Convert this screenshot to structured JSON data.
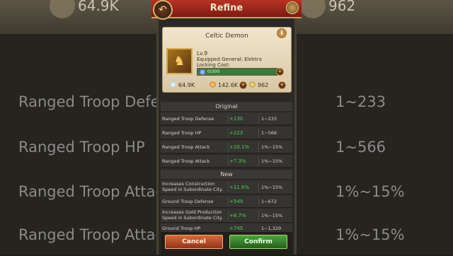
{
  "background": {
    "top_values": [
      "64.9K",
      "962"
    ],
    "rows": [
      {
        "label": "Ranged Troop Defe",
        "value": "1~233"
      },
      {
        "label": "Ranged Troop HP",
        "value": "1~566"
      },
      {
        "label": "Ranged Troop Attac",
        "value": "1%~15%"
      },
      {
        "label": "Ranged Troop Attac",
        "value": "1%~15%"
      }
    ]
  },
  "header": {
    "title": "Refine"
  },
  "card": {
    "name": "Celtic Demon",
    "level": "Lv.9",
    "equipped": "Equipped General: Elektra",
    "locking_label": "Locking Cost:",
    "locking_value": "0/300",
    "gems": "64.9K",
    "hammers": "142.6K",
    "coins": "962"
  },
  "original": {
    "heading": "Original",
    "rows": [
      {
        "name": "Ranged Troop Defense",
        "value": "+130",
        "range": "1~233"
      },
      {
        "name": "Ranged Troop HP",
        "value": "+223",
        "range": "1~566"
      },
      {
        "name": "Ranged Troop Attack",
        "value": "+10.1%",
        "range": "1%~15%"
      },
      {
        "name": "Ranged Troop Attack",
        "value": "+7.3%",
        "range": "1%~15%"
      }
    ]
  },
  "new": {
    "heading": "New",
    "rows": [
      {
        "name": "Increases Construction Speed in Subordinate City.",
        "value": "+11.6%",
        "range": "1%~15%"
      },
      {
        "name": "Ground Troop Defense",
        "value": "+549",
        "range": "1~672"
      },
      {
        "name": "Increases Gold Production Speed in Subordinate City.",
        "value": "+8.7%",
        "range": "1%~15%"
      },
      {
        "name": "Ground Troop HP",
        "value": "+745",
        "range": "1~1,329"
      }
    ]
  },
  "buttons": {
    "cancel": "Cancel",
    "confirm": "Confirm"
  },
  "icons": [
    "back-icon",
    "close-icon",
    "info-icon",
    "gem-icon",
    "hammer-icon",
    "coin-icon",
    "plus-icon"
  ],
  "colors": {
    "header_red": "#b63325",
    "bonus_green": "#4fd24f",
    "cancel_orange": "#d86a3a",
    "confirm_green": "#4ea33c"
  }
}
